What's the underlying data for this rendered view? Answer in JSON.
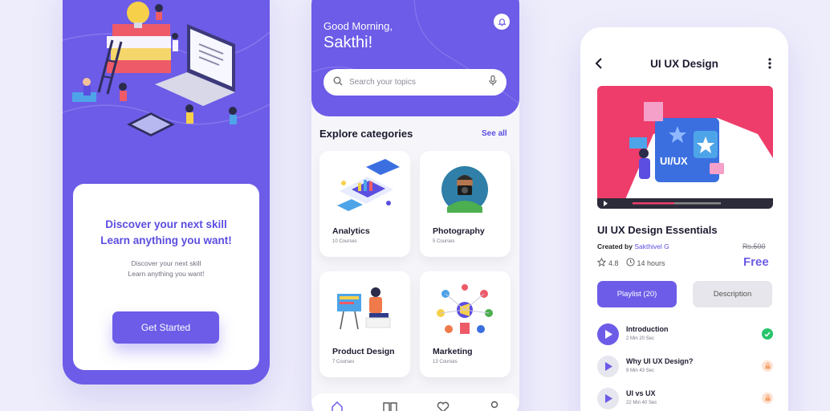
{
  "colors": {
    "accent": "#6c5ce7",
    "background": "#eeedfb",
    "done": "#27c46b",
    "locked": "#f5a06b"
  },
  "onboarding": {
    "headline_line1": "Discover your next skill",
    "headline_line2": "Learn anything you want!",
    "sub_line1": "Discover your next skill",
    "sub_line2": "Learn anything you want!",
    "cta_label": "Get Started"
  },
  "home": {
    "greeting": "Good Morning,",
    "user_name": "Sakthi!",
    "search_placeholder": "Search your topics",
    "section_title": "Explore categories",
    "see_all": "See all",
    "categories": [
      {
        "name": "Analytics",
        "count": "10 Courses",
        "icon": "analytics-illustration"
      },
      {
        "name": "Photography",
        "count": "5 Courses",
        "icon": "photographer-illustration"
      },
      {
        "name": "Product Design",
        "count": "7 Courses",
        "icon": "designer-illustration"
      },
      {
        "name": "Marketing",
        "count": "13 Courses",
        "icon": "marketing-illustration"
      }
    ],
    "nav": [
      "home-icon",
      "book-icon",
      "heart-icon",
      "profile-icon"
    ]
  },
  "course": {
    "page_title": "UI UX Design",
    "video_label": "UI/UX",
    "title": "UI UX Design Essentials",
    "created_by_label": "Created by",
    "author": "Sakthivel G",
    "old_price": "Rs.500",
    "price": "Free",
    "rating": "4.8",
    "duration": "14 hours",
    "tabs": [
      "Playlist (20)",
      "Description"
    ],
    "lessons": [
      {
        "name": "Introduction",
        "duration": "2 Min 20 Sec",
        "status": "done"
      },
      {
        "name": "Why UI UX Design?",
        "duration": "9 Min 43 Sec",
        "status": "locked"
      },
      {
        "name": "UI vs UX",
        "duration": "22 Min 40 Sec",
        "status": "locked"
      }
    ]
  }
}
